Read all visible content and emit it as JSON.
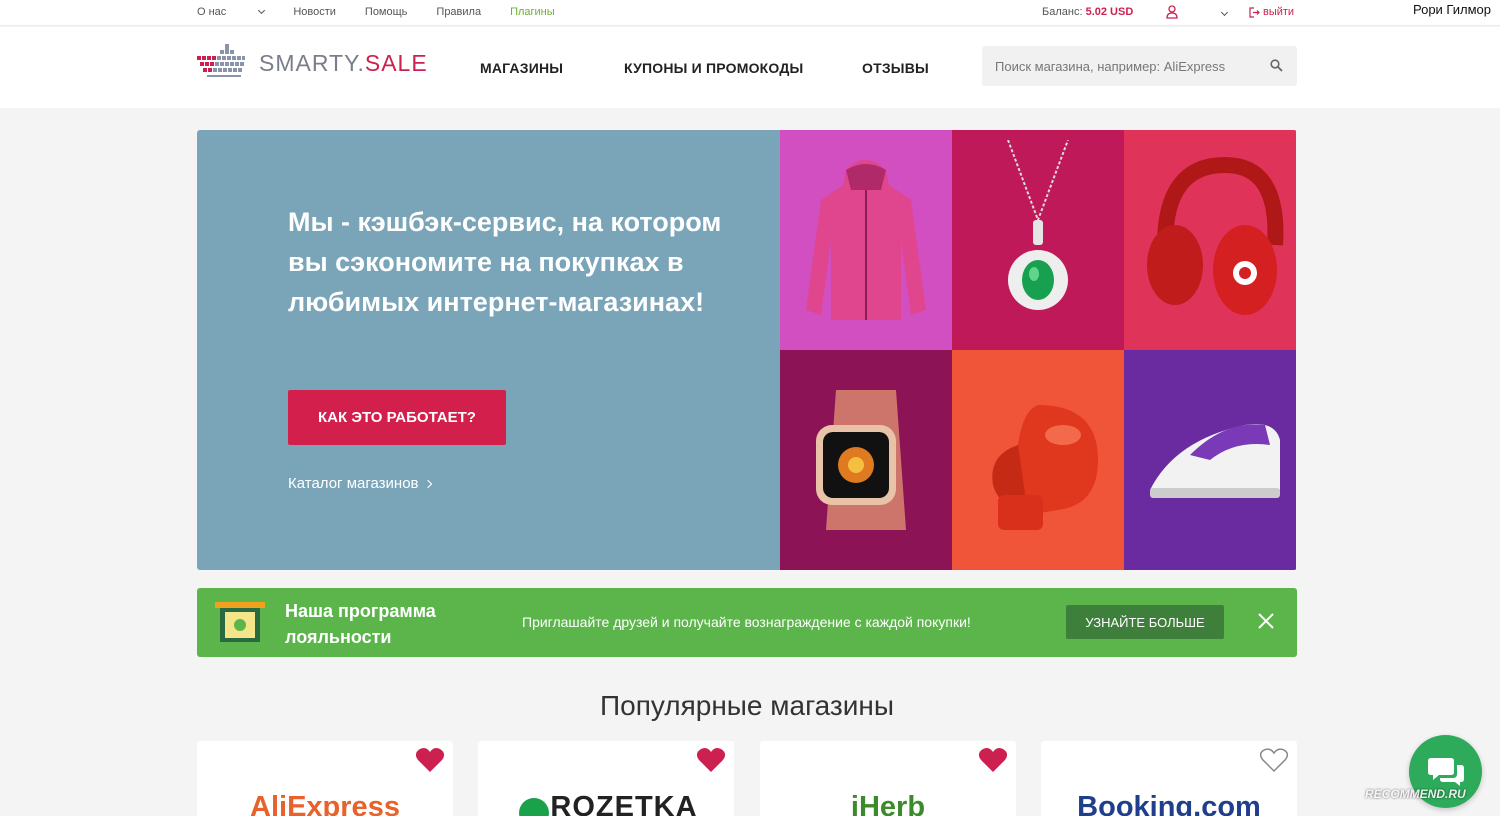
{
  "topbar": {
    "links": [
      {
        "label": "О нас",
        "has_dropdown": true
      },
      {
        "label": "Новости"
      },
      {
        "label": "Помощь"
      },
      {
        "label": "Правила"
      },
      {
        "label": "Плагины",
        "active": true
      }
    ],
    "balance_label": "Баланс:",
    "balance_value": "5.02 USD",
    "logout_label": "выйти",
    "username": "Рори Гилмор"
  },
  "header": {
    "logo_main": "SMARTY.",
    "logo_accent": "SALE",
    "nav": [
      "МАГАЗИНЫ",
      "КУПОНЫ И ПРОМОКОДЫ",
      "ОТЗЫВЫ"
    ],
    "search_placeholder": "Поиск магазина, например: AliExpress"
  },
  "hero": {
    "title": "Мы - кэшбэк-сервис, на котором вы сэкономите на покупках в любимых интернет-магазинах!",
    "button_label": "КАК ЭТО РАБОТАЕТ?",
    "catalog_link": "Каталог магазинов",
    "tiles": [
      {
        "icon": "pink-jacket",
        "bg": "#d14fc1"
      },
      {
        "icon": "emerald-pendant",
        "bg": "#c0195a"
      },
      {
        "icon": "red-headphones",
        "bg": "#e0335a"
      },
      {
        "icon": "smart-watch",
        "bg": "#8c1456"
      },
      {
        "icon": "boxing-glove",
        "bg": "#f0553a"
      },
      {
        "icon": "steam-iron",
        "bg": "#6a2aa0"
      }
    ]
  },
  "loyalty": {
    "title": "Наша программа лояльности",
    "text": "Приглашайте друзей и получайте вознаграждение с каждой покупки!",
    "button_label": "УЗНАЙТЕ БОЛЬШЕ"
  },
  "popular": {
    "title": "Популярные магазины",
    "stores": [
      {
        "name": "AliExpress",
        "favorite": true,
        "color": "#e8622c"
      },
      {
        "name": "ROZETKA",
        "favorite": true,
        "color": "#222222"
      },
      {
        "name": "iHerb",
        "favorite": true,
        "color": "#3a8c2a"
      },
      {
        "name": "Booking.com",
        "favorite": false,
        "color": "#1f3e8c"
      }
    ]
  },
  "watermark": "RECOMMEND.RU",
  "colors": {
    "accent": "#cc2150",
    "green": "#5cb54a",
    "hero_bg": "#7aa5b9"
  }
}
